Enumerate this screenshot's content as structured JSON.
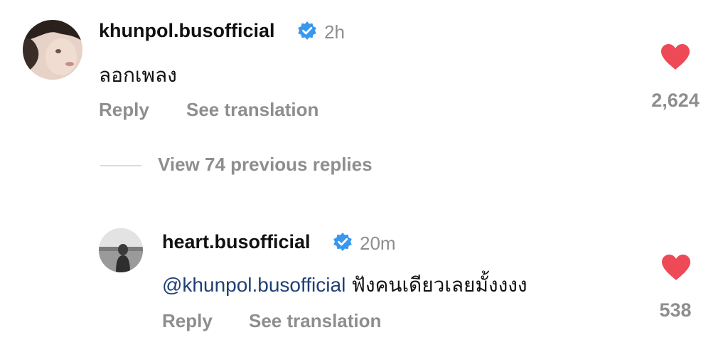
{
  "comment": {
    "username": "khunpol.busofficial",
    "verified_icon": "verified-badge-icon",
    "time": "2h",
    "text": "ลอกเพลง",
    "reply_label": "Reply",
    "translate_label": "See translation",
    "like_icon": "heart-filled-icon",
    "like_count": "2,624"
  },
  "view_replies_label": "View 74 previous replies",
  "reply": {
    "username": "heart.busofficial",
    "verified_icon": "verified-badge-icon",
    "time": "20m",
    "mention": "@khunpol.busofficial",
    "text": "ฟังคนเดียวเลยมั้งงงง",
    "reply_label": "Reply",
    "translate_label": "See translation",
    "like_icon": "heart-filled-icon",
    "like_count": "538"
  },
  "colors": {
    "heart": "#ed4956",
    "verified": "#3897f0",
    "secondary_text": "#8e8e8e",
    "mention": "#1f3f75"
  }
}
